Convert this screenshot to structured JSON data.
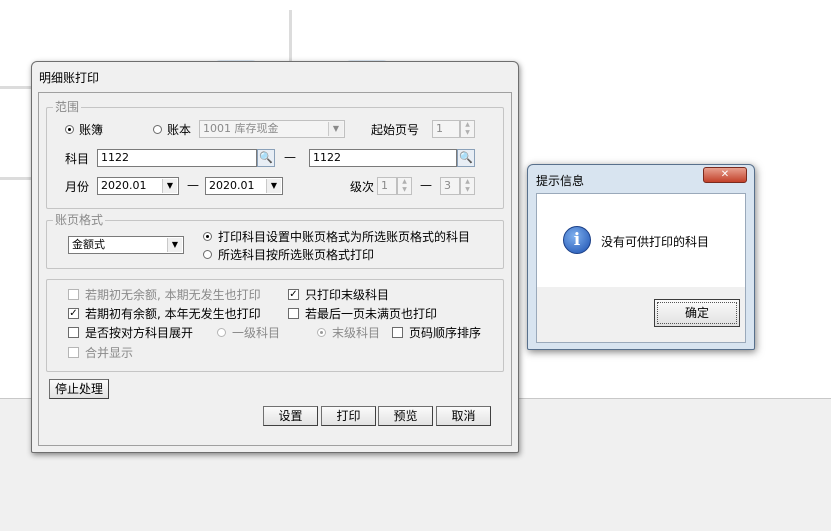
{
  "main_dialog": {
    "title": "明细账打印",
    "range": {
      "legend": "范围",
      "ledger_radio": "账簿",
      "book_radio": "账本",
      "book_select": "1001  库存现金",
      "start_page_label": "起始页号",
      "start_page_value": "1",
      "subject_label": "科目",
      "subject_from": "1122",
      "subject_to": "1122",
      "range_dash": "—",
      "month_label": "月份",
      "month_from": "2020.01",
      "month_to": "2020.01",
      "level_label": "级次",
      "level_from": "1",
      "level_to": "3"
    },
    "format": {
      "legend": "账页格式",
      "format_select": "金额式",
      "option1": "打印科目设置中账页格式为所选账页格式的科目",
      "option2": "所选科目按所选账页格式打印"
    },
    "options": {
      "opt_no_balance": "若期初无余额, 本期无发生也打印",
      "opt_last_level": "只打印末级科目",
      "opt_has_balance": "若期初有余额, 本年无发生也打印",
      "opt_last_page": "若最后一页未满页也打印",
      "opt_expand_contra": "是否按对方科目展开",
      "opt_first_level": "一级科目",
      "opt_last_level2": "末级科目",
      "opt_page_order": "页码顺序排序",
      "opt_merge": "合并显示"
    },
    "buttons": {
      "stop": "停止处理",
      "settings": "设置",
      "print": "打印",
      "preview": "预览",
      "cancel": "取消"
    }
  },
  "message_box": {
    "title": "提示信息",
    "close_glyph": "✕",
    "message": "没有可供打印的科目",
    "ok": "确定"
  }
}
